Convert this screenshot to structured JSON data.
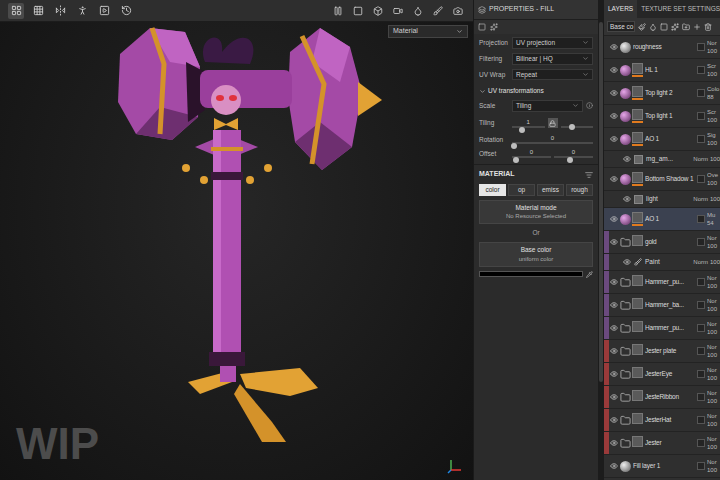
{
  "toolbar": {
    "left": [
      {
        "selected": true
      },
      {
        "selected": false
      },
      {
        "selected": false
      },
      {
        "selected": false
      },
      {
        "selected": false
      },
      {
        "selected": false
      }
    ],
    "right": [
      {
        "selected": false
      },
      {
        "selected": false
      },
      {
        "selected": false
      },
      {
        "selected": false
      },
      {
        "selected": false
      },
      {
        "selected": false
      },
      {
        "selected": false
      }
    ]
  },
  "viewport": {
    "mode": "Material",
    "watermark": "WIP"
  },
  "properties": {
    "title": "PROPERTIES - FILL",
    "fields": [
      {
        "label": "Projection",
        "value": "UV projection"
      },
      {
        "label": "Filtering",
        "value": "Bilinear | HQ"
      },
      {
        "label": "UV Wrap",
        "value": "Repeat"
      }
    ],
    "uv_section": {
      "title": "UV transformations",
      "expanded": true
    },
    "scale": {
      "label": "Scale",
      "value": "Tiling"
    },
    "tiling": {
      "label": "Tiling",
      "value": "1",
      "locked": true,
      "level": 0.3,
      "level2": 0.35
    },
    "rotation": {
      "label": "Rotation",
      "value": "0",
      "level": 0.03
    },
    "offset": {
      "label": "Offset",
      "values": [
        "0",
        "0"
      ],
      "levels": [
        0.1,
        0.4
      ]
    },
    "material": {
      "title": "MATERIAL",
      "channels": [
        {
          "label": "color",
          "selected": true
        },
        {
          "label": "op",
          "selected": false
        },
        {
          "label": "emiss",
          "selected": false
        },
        {
          "label": "rough",
          "selected": false
        }
      ],
      "mode": {
        "title": "Material mode",
        "subtitle": "No Resource Selected"
      },
      "or": "Or",
      "base": {
        "title": "Base color",
        "subtitle": "uniform color"
      },
      "swatch": "#000000"
    }
  },
  "layers_panel": {
    "tabs": [
      {
        "label": "LAYERS",
        "selected": true
      },
      {
        "label": "TEXTURE SET SETTINGS",
        "selected": false
      }
    ],
    "channel": "Base co",
    "layers": [
      {
        "kind": "fill",
        "name": "roughness",
        "blend": "Nor",
        "opacity": "100",
        "selected": false,
        "mask_active": false,
        "color": ""
      },
      {
        "kind": "layer",
        "name": "HL 1",
        "blend": "Scr",
        "opacity": "100",
        "selected": false,
        "mask_active": true,
        "color": ""
      },
      {
        "kind": "layer",
        "name": "Top light 2",
        "blend": "Colo",
        "opacity": "88",
        "selected": false,
        "mask_active": true,
        "color": ""
      },
      {
        "kind": "layer",
        "name": "Top light 1",
        "blend": "Scr",
        "opacity": "100",
        "selected": false,
        "mask_active": true,
        "color": ""
      },
      {
        "kind": "layer",
        "name": "AO 1",
        "blend": "Sig",
        "opacity": "100",
        "selected": false,
        "mask_active": true,
        "color": ""
      },
      {
        "kind": "effect",
        "name": "mg_am...",
        "blend": "Norm",
        "opacity": "100",
        "selected": false,
        "mask_active": false,
        "color": ""
      },
      {
        "kind": "layer",
        "name": "Bottom Shadow 1",
        "blend": "Ove",
        "opacity": "100",
        "selected": false,
        "mask_active": true,
        "color": ""
      },
      {
        "kind": "effect",
        "name": "light",
        "blend": "Norm",
        "opacity": "100",
        "selected": false,
        "mask_active": false,
        "color": ""
      },
      {
        "kind": "layer",
        "name": "AO 1",
        "blend": "Mu",
        "opacity": "54",
        "selected": true,
        "mask_active": true,
        "color": ""
      },
      {
        "kind": "group",
        "name": "gold",
        "blend": "Nor",
        "opacity": "100",
        "selected": false,
        "mask_active": false,
        "color": "#6b4a7e"
      },
      {
        "kind": "paint",
        "name": "Paint",
        "blend": "Norm",
        "opacity": "100",
        "selected": false,
        "mask_active": false,
        "color": "#6b4a7e"
      },
      {
        "kind": "group",
        "name": "Hammer_pu...",
        "blend": "Nor",
        "opacity": "100",
        "selected": false,
        "mask_active": false,
        "color": "#6b4a7e"
      },
      {
        "kind": "group",
        "name": "Hammer_ba...",
        "blend": "Nor",
        "opacity": "100",
        "selected": false,
        "mask_active": false,
        "color": "#6b4a7e"
      },
      {
        "kind": "group",
        "name": "Hammer_pu...",
        "blend": "Nor",
        "opacity": "100",
        "selected": false,
        "mask_active": false,
        "color": "#6b4a7e"
      },
      {
        "kind": "group",
        "name": "Jester plate",
        "blend": "Nor",
        "opacity": "100",
        "selected": false,
        "mask_active": false,
        "color": "#9a3a3a"
      },
      {
        "kind": "group",
        "name": "JesterEye",
        "blend": "Nor",
        "opacity": "100",
        "selected": false,
        "mask_active": false,
        "color": "#9a3a3a"
      },
      {
        "kind": "group",
        "name": "JesteRibbon",
        "blend": "Nor",
        "opacity": "100",
        "selected": false,
        "mask_active": false,
        "color": "#9a3a3a"
      },
      {
        "kind": "group",
        "name": "JesterHat",
        "blend": "Nor",
        "opacity": "100",
        "selected": false,
        "mask_active": false,
        "color": "#9a3a3a"
      },
      {
        "kind": "group",
        "name": "Jester",
        "blend": "Nor",
        "opacity": "100",
        "selected": false,
        "mask_active": false,
        "color": "#9a3a3a"
      },
      {
        "kind": "fill",
        "name": "Fill layer 1",
        "blend": "Nor",
        "opacity": "100",
        "selected": false,
        "mask_active": false,
        "color": ""
      }
    ]
  }
}
